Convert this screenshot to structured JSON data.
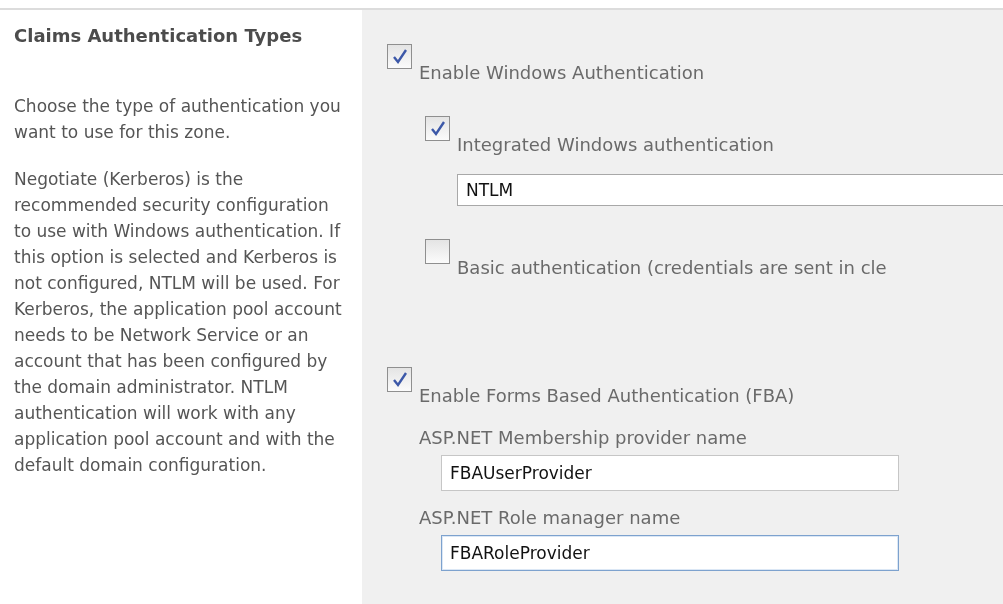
{
  "section": {
    "title": "Claims Authentication Types",
    "paragraphs": [
      "Choose the type of authentication you want to use for this zone.",
      "Negotiate (Kerberos) is the recommended security configuration to use with Windows authentication. If this option is selected and Kerberos is not configured, NTLM will be used. For Kerberos, the application pool account needs to be Network Service or an account that has been configured by the domain administrator. NTLM authentication will work with any application pool account and with the default domain configuration."
    ]
  },
  "settings": [
    {
      "kind": "options",
      "label": "Enable Windows Authentication",
      "checked": true,
      "options": [
        {
          "label": "Integrated Windows authentication",
          "checked": true,
          "value": "NTLM"
        },
        {
          "label": "Basic authentication (credentials are sent in cle",
          "checked": false
        }
      ]
    },
    {
      "kind": "fields",
      "label": "Enable Forms Based Authentication (FBA)",
      "checked": true,
      "fields": [
        {
          "label": "ASP.NET Membership provider name",
          "value": "FBAUserProvider",
          "focused": false
        },
        {
          "label": "ASP.NET Role manager name",
          "value": "FBARoleProvider",
          "focused": true
        }
      ]
    }
  ]
}
